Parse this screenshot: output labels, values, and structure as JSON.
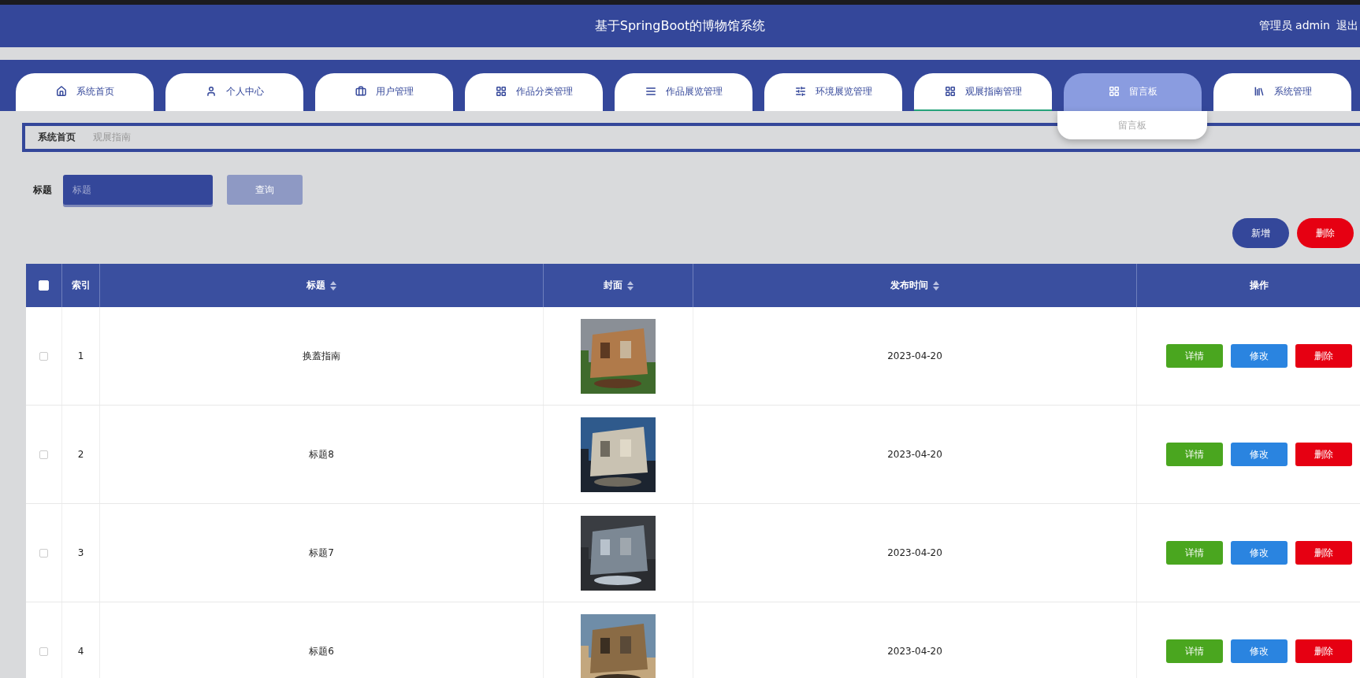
{
  "header": {
    "title": "基于SpringBoot的博物馆系统",
    "user": "管理员 admin",
    "logout": "退出"
  },
  "tabs": [
    {
      "label": "系统首页",
      "selected": false,
      "hovered": false
    },
    {
      "label": "个人中心",
      "selected": false,
      "hovered": false
    },
    {
      "label": "用户管理",
      "selected": false,
      "hovered": false
    },
    {
      "label": "作品分类管理",
      "selected": false,
      "hovered": false
    },
    {
      "label": "作品展览管理",
      "selected": false,
      "hovered": false
    },
    {
      "label": "环境展览管理",
      "selected": false,
      "hovered": false
    },
    {
      "label": "观展指南管理",
      "selected": true,
      "hovered": false
    },
    {
      "label": "留言板",
      "selected": false,
      "hovered": true,
      "expanded": true,
      "menu": [
        "留言板"
      ]
    },
    {
      "label": "系统管理",
      "selected": false,
      "hovered": false
    }
  ],
  "breadcrumb": [
    "系统首页",
    "观展指南"
  ],
  "search": {
    "label": "标题",
    "placeholder": "标题",
    "button": "查询"
  },
  "actions": [
    {
      "label": "新增",
      "kind": "add"
    },
    {
      "label": "删除",
      "kind": "delete"
    }
  ],
  "table": {
    "select_all": {
      "checked": false
    },
    "columns": [
      {
        "label": "索引",
        "sortable": false
      },
      {
        "label": "标题",
        "sortable": true
      },
      {
        "label": "封面",
        "sortable": true
      },
      {
        "label": "发布时间",
        "sortable": true
      },
      {
        "label": "操作",
        "sortable": false
      }
    ],
    "rows": [
      {
        "checked": false,
        "index": "1",
        "title": "换蓋指南",
        "cover": {
          "kind": "picture"
        },
        "date": "2023-04-20",
        "buttons": [
          {
            "label": "详情",
            "kind": "detail"
          },
          {
            "label": "修改",
            "kind": "edit"
          },
          {
            "label": "删除",
            "kind": "delete"
          }
        ]
      },
      {
        "checked": false,
        "index": "2",
        "title": "标题8",
        "cover": {
          "kind": "picture"
        },
        "date": "2023-04-20",
        "buttons": [
          {
            "label": "详情",
            "kind": "detail"
          },
          {
            "label": "修改",
            "kind": "edit"
          },
          {
            "label": "删除",
            "kind": "delete"
          }
        ]
      },
      {
        "checked": false,
        "index": "3",
        "title": "标题7",
        "cover": {
          "kind": "picture"
        },
        "date": "2023-04-20",
        "buttons": [
          {
            "label": "详情",
            "kind": "detail"
          },
          {
            "label": "修改",
            "kind": "edit"
          },
          {
            "label": "删除",
            "kind": "delete"
          }
        ]
      },
      {
        "checked": false,
        "index": "4",
        "title": "标题6",
        "cover": {
          "kind": "picture"
        },
        "date": "2023-04-20",
        "buttons": [
          {
            "label": "详情",
            "kind": "detail"
          },
          {
            "label": "修改",
            "kind": "edit"
          },
          {
            "label": "删除",
            "kind": "delete"
          }
        ]
      }
    ]
  }
}
